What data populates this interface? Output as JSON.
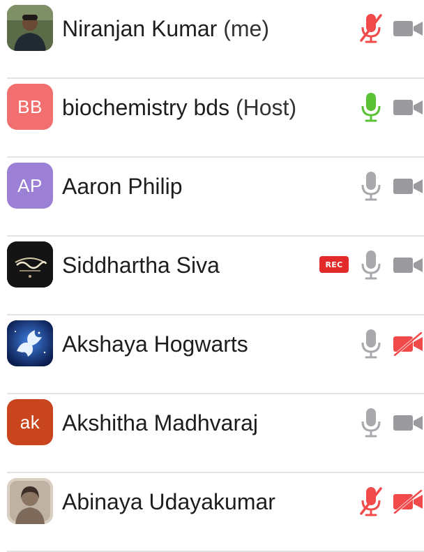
{
  "participants": [
    {
      "name": "Niranjan Kumar",
      "suffix": "(me)",
      "avatar": {
        "type": "photo",
        "icon": "user-photo-avatar",
        "color": "#4a5a3c"
      },
      "mic": {
        "state": "muted",
        "color": "#f04a4a"
      },
      "camera": {
        "state": "on",
        "color": "#9a9a9f"
      },
      "recording": false
    },
    {
      "name": "biochemistry bds",
      "suffix": "(Host)",
      "avatar": {
        "type": "initials",
        "initials": "BB",
        "color": "#f26f6f"
      },
      "mic": {
        "state": "speaking",
        "color": "#5bc236"
      },
      "camera": {
        "state": "on",
        "color": "#9a9a9f"
      },
      "recording": false
    },
    {
      "name": "Aaron Philip",
      "suffix": "",
      "avatar": {
        "type": "initials",
        "initials": "AP",
        "color": "#9b80d6"
      },
      "mic": {
        "state": "unmuted",
        "color": "#a8a8ad"
      },
      "camera": {
        "state": "on",
        "color": "#9a9a9f"
      },
      "recording": false
    },
    {
      "name": "Siddhartha Siva",
      "suffix": "",
      "avatar": {
        "type": "logo",
        "icon": "logo-avatar",
        "color": "#141414"
      },
      "mic": {
        "state": "unmuted",
        "color": "#a8a8ad"
      },
      "camera": {
        "state": "on",
        "color": "#9a9a9f"
      },
      "recording": true,
      "rec_label": "REC"
    },
    {
      "name": "Akshaya Hogwarts",
      "suffix": "",
      "avatar": {
        "type": "image",
        "icon": "pegasus-avatar",
        "color": "#1b3f8a"
      },
      "mic": {
        "state": "unmuted",
        "color": "#a8a8ad"
      },
      "camera": {
        "state": "off",
        "color": "#f04a4a"
      },
      "recording": false
    },
    {
      "name": "Akshitha Madhvaraj",
      "suffix": "",
      "avatar": {
        "type": "initials",
        "initials": "ak",
        "color": "#c8451d"
      },
      "mic": {
        "state": "unmuted",
        "color": "#a8a8ad"
      },
      "camera": {
        "state": "on",
        "color": "#9a9a9f"
      },
      "recording": false
    },
    {
      "name": "Abinaya Udayakumar",
      "suffix": "",
      "avatar": {
        "type": "photo",
        "icon": "user-photo-avatar",
        "color": "#b8a89a"
      },
      "mic": {
        "state": "muted",
        "color": "#f04a4a"
      },
      "camera": {
        "state": "off",
        "color": "#f04a4a"
      },
      "recording": false
    }
  ]
}
